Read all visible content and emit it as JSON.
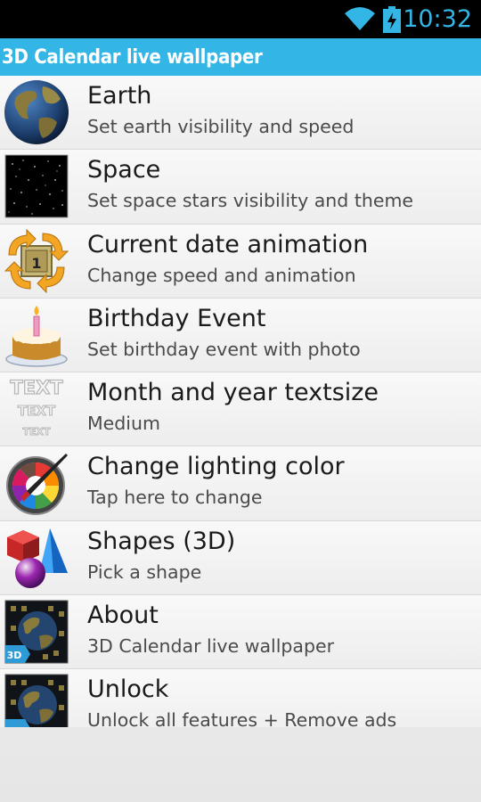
{
  "status_bar": {
    "time": "10:32",
    "icons": [
      "wifi-icon",
      "battery-charging-icon"
    ],
    "accent_color": "#33b5e5"
  },
  "app_bar": {
    "title": "3D Calendar live wallpaper",
    "color": "#33b5e5"
  },
  "settings": [
    {
      "label": "Earth",
      "summary": "Set earth visibility and speed",
      "icon": "earth-icon"
    },
    {
      "label": "Space",
      "summary": "Set space stars visibility and theme",
      "icon": "starfield-icon"
    },
    {
      "label": "Current date animation",
      "summary": "Change speed and animation",
      "icon": "date-rotate-icon"
    },
    {
      "label": "Birthday Event",
      "summary": "Set birthday event with photo",
      "icon": "birthday-cake-icon"
    },
    {
      "label": "Month and year textsize",
      "summary": "Medium",
      "icon": "text-size-icon",
      "icon_text": "TEXT"
    },
    {
      "label": "Change lighting color",
      "summary": "Tap here to change",
      "icon": "color-palette-icon"
    },
    {
      "label": "Shapes (3D)",
      "summary": "Pick a shape",
      "icon": "shapes-icon"
    },
    {
      "label": "About",
      "summary": "3D Calendar live wallpaper",
      "icon": "app-3d-icon",
      "icon_text": "3D"
    },
    {
      "label": "Unlock",
      "summary": "Unlock all features + Remove ads",
      "icon": "app-unlock-icon"
    }
  ]
}
